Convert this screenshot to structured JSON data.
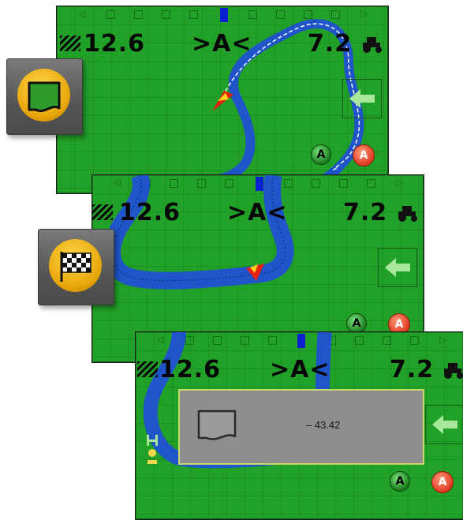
{
  "screens": [
    {
      "swath_width": "12.6",
      "guidance_mode": ">A<",
      "speed": "7.2",
      "mark_a_label": "A",
      "mark_a_active_label": "A"
    },
    {
      "swath_width": "12.6",
      "guidance_mode": ">A<",
      "speed": "7.2",
      "mark_a_label": "A",
      "mark_a_active_label": "A"
    },
    {
      "swath_width": "12.6",
      "guidance_mode": ">A<",
      "speed": "7.2",
      "mark_a_label": "A",
      "mark_a_active_label": "A",
      "area_value": "– 43.42"
    }
  ],
  "icons": {
    "boundary_button": "boundary-icon",
    "finish_button": "checkered-flag-icon",
    "back_arrow": "arrow-left-icon",
    "tractor": "tractor-icon"
  },
  "colors": {
    "field_green": "#22a128",
    "path_blue": "#1f55c8",
    "mark_red": "#e03a22",
    "button_gold": "#e8a60a"
  }
}
